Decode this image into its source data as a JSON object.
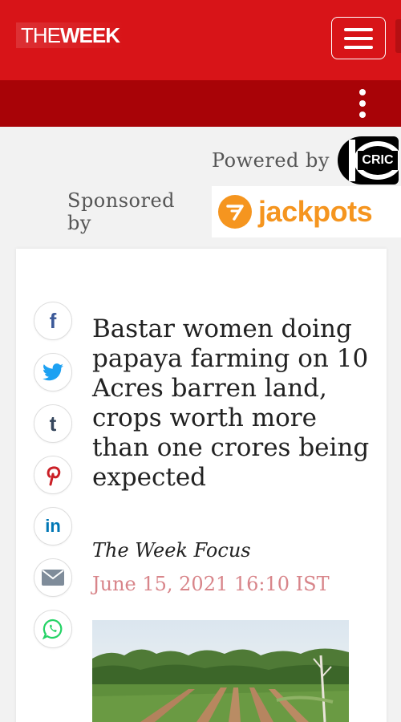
{
  "header": {
    "logo_the": "THE",
    "logo_week": "WEEK",
    "menu_icon": "hamburger-icon",
    "more_icon": "vertical-dots-icon",
    "brand_color": "#d81418",
    "subbar_color": "#a80307"
  },
  "sponsors": {
    "powered_by_label": "Powered by",
    "powered_by_logo_text": "CRIC",
    "sponsored_by_label": "Sponsored by",
    "sponsored_by_logo_text": "jackpots",
    "jackpots_color": "#f5951f"
  },
  "share": {
    "icons": [
      "facebook-icon",
      "twitter-icon",
      "tumblr-icon",
      "pinterest-icon",
      "linkedin-icon",
      "email-icon",
      "whatsapp-icon"
    ],
    "facebook_glyph": "f",
    "tumblr_glyph": "t",
    "linkedin_glyph": "in"
  },
  "article": {
    "headline": "Bastar women doing papaya farming on 10 Acres barren land, crops worth more than one crores being expected",
    "author": "The Week Focus",
    "date": "June 15, 2021 16:10 IST",
    "date_color": "#d8858a"
  }
}
